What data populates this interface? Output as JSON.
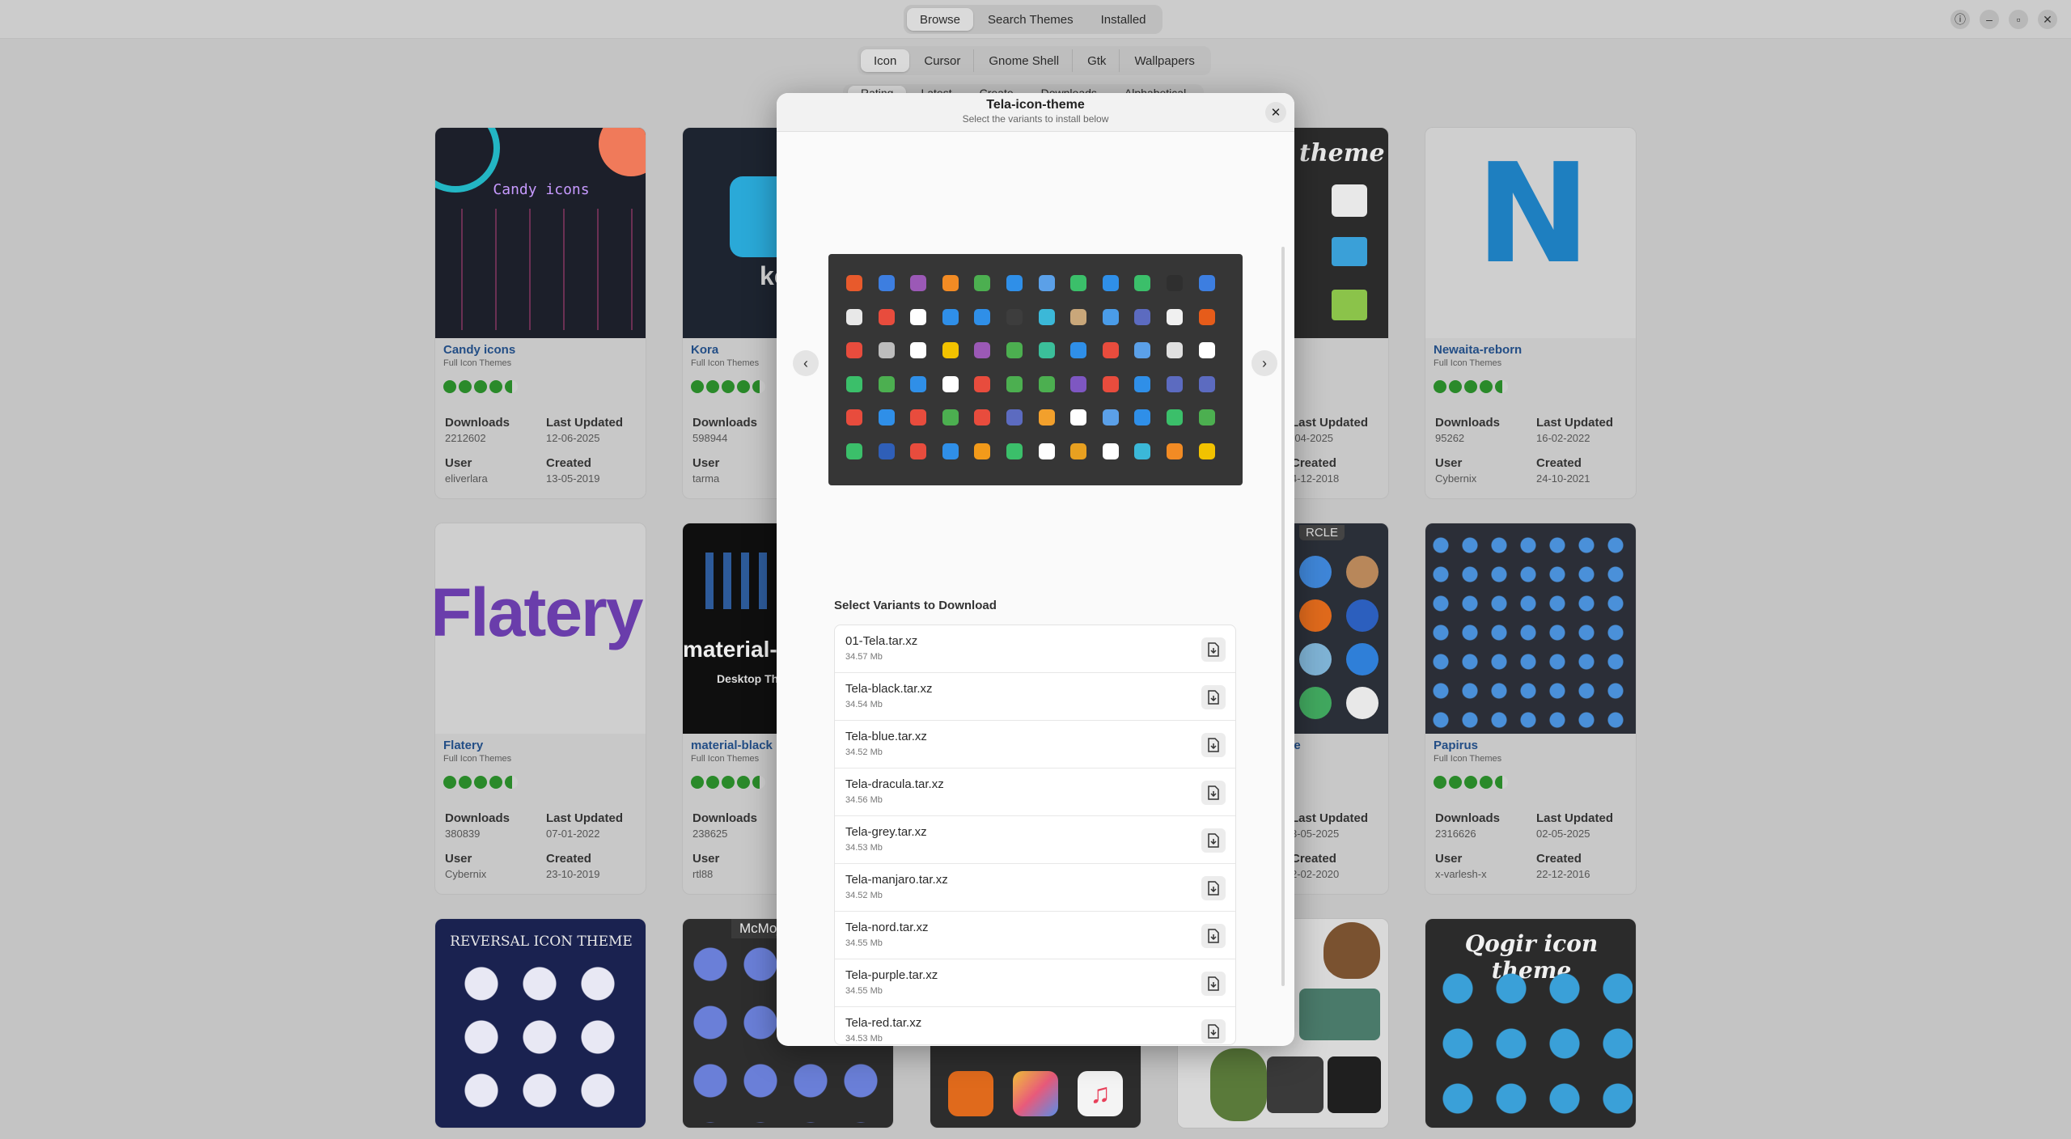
{
  "header": {
    "tabs": [
      {
        "label": "Browse",
        "active": true
      },
      {
        "label": "Search Themes",
        "active": false
      },
      {
        "label": "Installed",
        "active": false
      }
    ],
    "window_controls": [
      {
        "icon": "info-icon",
        "glyph": "ⓘ"
      },
      {
        "icon": "minimize-icon",
        "glyph": "–"
      },
      {
        "icon": "maximize-icon",
        "glyph": "▫"
      },
      {
        "icon": "close-icon",
        "glyph": "✕"
      }
    ]
  },
  "category_tabs": [
    {
      "label": "Icon",
      "active": true
    },
    {
      "label": "Cursor",
      "active": false
    },
    {
      "label": "Gnome Shell",
      "active": false
    },
    {
      "label": "Gtk",
      "active": false
    },
    {
      "label": "Wallpapers",
      "active": false
    }
  ],
  "sort_tabs": [
    "Rating",
    "Latest",
    "Create",
    "Downloads",
    "Alphabetical"
  ],
  "labels": {
    "downloads": "Downloads",
    "last_updated": "Last Updated",
    "user": "User",
    "created": "Created"
  },
  "cards": [
    {
      "name": "Candy icons",
      "subtitle": "Full Icon Themes",
      "downloads": "2212602",
      "last_updated": "12-06-2025",
      "user": "eliverlara",
      "created": "13-05-2019",
      "rating_stars": 4.5,
      "image_text": "Candy icons"
    },
    {
      "name": "Kora",
      "subtitle": "Full Icon Themes",
      "downloads": "598944",
      "last_updated": "",
      "user": "tarma",
      "created": "",
      "rating_stars": 4.5,
      "image_text": "ko"
    },
    {
      "name": "",
      "subtitle": "",
      "downloads": "",
      "last_updated": "-04-2025",
      "user": "",
      "created": "4-12-2018",
      "rating_stars": 0,
      "image_text": "theme"
    },
    {
      "name": "Newaita-reborn",
      "subtitle": "Full Icon Themes",
      "downloads": "95262",
      "last_updated": "16-02-2022",
      "user": "Cybernix",
      "created": "24-10-2021",
      "rating_stars": 4.5,
      "image_text": "N"
    },
    {
      "name": "Flatery",
      "subtitle": "Full Icon Themes",
      "downloads": "380839",
      "last_updated": "07-01-2022",
      "user": "Cybernix",
      "created": "23-10-2019",
      "rating_stars": 4.5,
      "image_text": "Flatery"
    },
    {
      "name": "material-black",
      "subtitle": "Full Icon Themes",
      "downloads": "238625",
      "last_updated": "",
      "user": "rtl88",
      "created": "",
      "rating_stars": 4.5,
      "image_text": "material-b",
      "image_text2": "Desktop Th"
    },
    {
      "name": "me",
      "subtitle": "",
      "downloads": "",
      "last_updated": "3-05-2025",
      "user": "",
      "created": "2-02-2020",
      "rating_stars": 0,
      "image_text": "RCLE"
    },
    {
      "name": "Papirus",
      "subtitle": "Full Icon Themes",
      "downloads": "2316626",
      "last_updated": "02-05-2025",
      "user": "x-varlesh-x",
      "created": "22-12-2016",
      "rating_stars": 4.5,
      "image_text": ""
    },
    {
      "name": "",
      "subtitle": "",
      "image_text": "REVERSAL ICON THEME"
    },
    {
      "name": "",
      "subtitle": "",
      "image_text": "McMoj"
    },
    {
      "name": "",
      "subtitle": "",
      "image_text": ""
    },
    {
      "name": "",
      "subtitle": "",
      "image_text": ""
    },
    {
      "name": "",
      "subtitle": "",
      "image_text": "Qogir icon theme"
    }
  ],
  "modal": {
    "title": "Tela-icon-theme",
    "subtitle": "Select the variants to install below",
    "close_glyph": "✕",
    "prev_glyph": "‹",
    "next_glyph": "›",
    "section_title": "Select Variants to Download",
    "variants": [
      {
        "name": "01-Tela.tar.xz",
        "size": "34.57 Mb"
      },
      {
        "name": "Tela-black.tar.xz",
        "size": "34.54 Mb"
      },
      {
        "name": "Tela-blue.tar.xz",
        "size": "34.52 Mb"
      },
      {
        "name": "Tela-dracula.tar.xz",
        "size": "34.56 Mb"
      },
      {
        "name": "Tela-grey.tar.xz",
        "size": "34.53 Mb"
      },
      {
        "name": "Tela-manjaro.tar.xz",
        "size": "34.52 Mb"
      },
      {
        "name": "Tela-nord.tar.xz",
        "size": "34.55 Mb"
      },
      {
        "name": "Tela-purple.tar.xz",
        "size": "34.55 Mb"
      },
      {
        "name": "Tela-red.tar.xz",
        "size": "34.53 Mb"
      }
    ],
    "preview_icon_colors": [
      "#e85a2c",
      "#3d7ee0",
      "#9b59b6",
      "#f28b24",
      "#4caf50",
      "#2f8fe8",
      "#5ba0e8",
      "#3bbf6a",
      "#2f8fe8",
      "#3bbf6a",
      "#2f2f2f",
      "#3d7ee0",
      "#e8e8e8",
      "#e84c3d",
      "#ffffff",
      "#2f8fe8",
      "#2f8fe8",
      "#3d3d3d",
      "#3bb8d8",
      "#c9a77a",
      "#4a9ce8",
      "#5c6bc0",
      "#f0f0f0",
      "#e65c1a",
      "#e84c3d",
      "#bdbdbd",
      "#ffffff",
      "#f2c200",
      "#9b59b6",
      "#4caf50",
      "#3bbf9a",
      "#2f8fe8",
      "#e84c3d",
      "#5ba0e8",
      "#e0e0e0",
      "#ffffff",
      "#3bbf6a",
      "#4caf50",
      "#2f8fe8",
      "#ffffff",
      "#e84c3d",
      "#4caf50",
      "#4caf50",
      "#7e57c2",
      "#e84c3d",
      "#2f8fe8",
      "#5c6bc0",
      "#5c6bc0",
      "#e84c3d",
      "#2f8fe8",
      "#e84c3d",
      "#4caf50",
      "#e84c3d",
      "#5c6bc0",
      "#f2a02c",
      "#ffffff",
      "#5ba0e8",
      "#2f8fe8",
      "#3bbf6a",
      "#4caf50",
      "#3bbf6a",
      "#2f5fb8",
      "#e84c3d",
      "#2f8fe8",
      "#f29a1a",
      "#3bbf6a",
      "#ffffff",
      "#e8a020",
      "#ffffff",
      "#3bb8d8",
      "#f28b24",
      "#f2c200"
    ]
  }
}
